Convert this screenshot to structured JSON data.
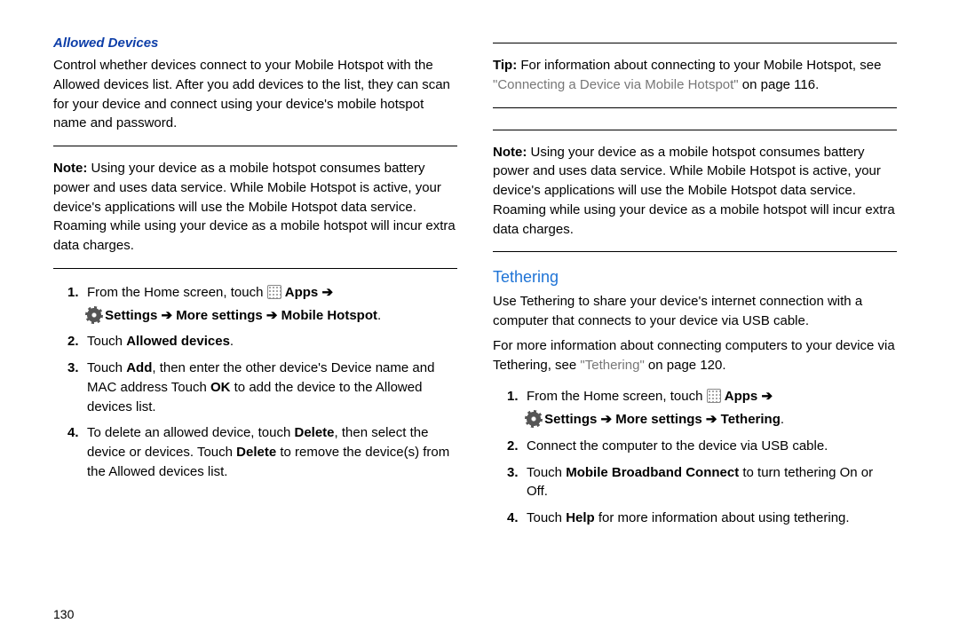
{
  "left": {
    "heading": "Allowed Devices",
    "intro": "Control whether devices connect to your Mobile Hotspot with the Allowed devices list. After you add devices to the list, they can scan for your device and connect using your device's mobile hotspot name and password.",
    "note_label": "Note:",
    "note_body": "Using your device as a mobile hotspot consumes battery power and uses data service. While Mobile Hotspot is active, your device's applications will use the Mobile Hotspot data service. Roaming while using your device as a mobile hotspot will incur extra data charges.",
    "step1_a": "From the Home screen, touch ",
    "apps": "Apps",
    "arrow": "➔",
    "settings_path": "Settings ➔ More settings ➔ Mobile Hotspot",
    "step2_a": "Touch ",
    "step2_b": "Allowed devices",
    "step3_a": "Touch ",
    "step3_b": "Add",
    "step3_c": ", then enter the other device's Device name and MAC address Touch ",
    "step3_d": "OK",
    "step3_e": " to add the device to the Allowed devices list.",
    "step4_a": "To delete an allowed device, touch ",
    "step4_b": "Delete",
    "step4_c": ", then select the device or devices. Touch ",
    "step4_d": "Delete",
    "step4_e": " to remove the device(s) from the Allowed devices list.",
    "page": "130"
  },
  "right": {
    "tip_label": "Tip:",
    "tip_a": "For information about connecting to your Mobile Hotspot, see ",
    "tip_ref": "\"Connecting a Device via Mobile Hotspot\"",
    "tip_b": " on page 116.",
    "note_label": "Note:",
    "note_body": "Using your device as a mobile hotspot consumes battery power and uses data service. While Mobile Hotspot is active, your device's applications will use the Mobile Hotspot data service. Roaming while using your device as a mobile hotspot will incur extra data charges.",
    "heading": "Tethering",
    "intro1": "Use Tethering to share your device's internet connection with a computer that connects to your device via USB cable.",
    "intro2a": "For more information about connecting computers to your device via Tethering, see ",
    "intro2ref": "\"Tethering\"",
    "intro2b": " on page 120.",
    "step1_a": "From the Home screen, touch ",
    "apps": "Apps",
    "arrow": "➔",
    "settings_path": "Settings ➔ More settings ➔ Tethering",
    "step2": "Connect the computer to the device via USB cable.",
    "step3_a": "Touch ",
    "step3_b": "Mobile Broadband Connect",
    "step3_c": " to turn tethering On or Off.",
    "step4_a": "Touch ",
    "step4_b": "Help",
    "step4_c": " for more information about using tethering."
  }
}
